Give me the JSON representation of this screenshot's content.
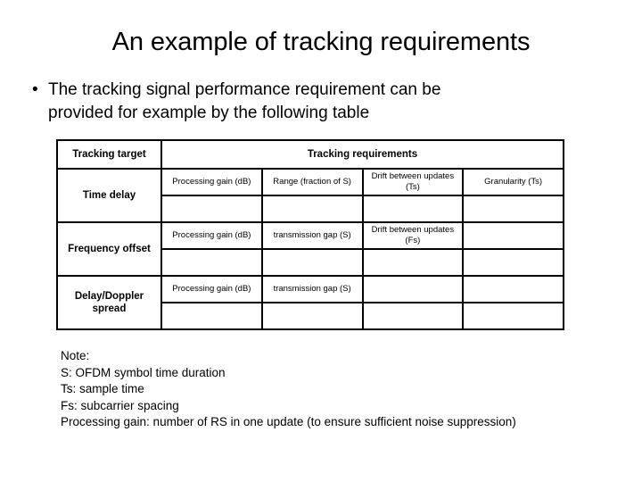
{
  "slide": {
    "title": "An example of tracking requirements"
  },
  "bullet": {
    "marker": "•",
    "line1": "The tracking signal performance requirement can be",
    "line2": "provided for example by the following table"
  },
  "table": {
    "header": {
      "target_label": "Tracking target",
      "requirements_label": "Tracking requirements"
    },
    "groups": [
      {
        "target": "Time delay",
        "labels": [
          "Processing gain (dB)",
          "Range (fraction of S)",
          "Drift between updates (Ts)",
          "Granularity (Ts)"
        ],
        "values": [
          "",
          "",
          "",
          ""
        ]
      },
      {
        "target": "Frequency offset",
        "labels": [
          "Processing gain (dB)",
          "transmission gap (S)",
          "Drift between updates (Fs)",
          ""
        ],
        "values": [
          "",
          "",
          "",
          ""
        ]
      },
      {
        "target": "Delay/Doppler spread",
        "labels": [
          "Processing gain (dB)",
          "transmission gap (S)",
          "",
          ""
        ],
        "values": [
          "",
          "",
          "",
          ""
        ]
      }
    ]
  },
  "notes": {
    "line0": "Note:",
    "line1": "S: OFDM symbol time duration",
    "line2": "Ts: sample time",
    "line3": "Fs: subcarrier spacing",
    "line4": "Processing gain: number of RS in one update (to ensure sufficient noise suppression)"
  },
  "colors": {
    "background": "#ffffff",
    "text": "#000000",
    "table_border": "#000000"
  }
}
